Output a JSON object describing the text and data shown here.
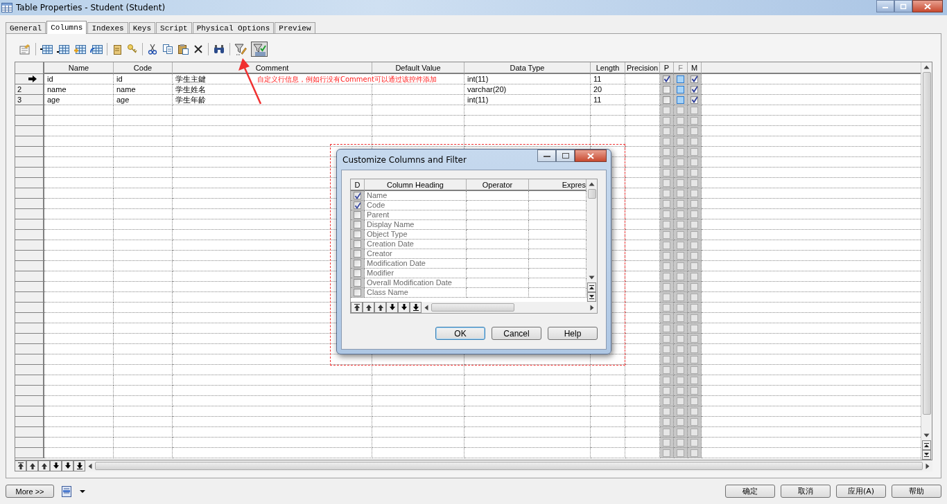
{
  "window": {
    "title": "Table Properties - Student (Student)"
  },
  "tabs": [
    {
      "label": "General",
      "selected": false
    },
    {
      "label": "Columns",
      "selected": true
    },
    {
      "label": "Indexes",
      "selected": false
    },
    {
      "label": "Keys",
      "selected": false
    },
    {
      "label": "Script",
      "selected": false
    },
    {
      "label": "Physical Options",
      "selected": false
    },
    {
      "label": "Preview",
      "selected": false
    }
  ],
  "toolbar": {
    "filter_pressed": true
  },
  "grid": {
    "columns": [
      {
        "label": "Name",
        "disabled": false
      },
      {
        "label": "Code",
        "disabled": false
      },
      {
        "label": "Comment",
        "disabled": false
      },
      {
        "label": "Default Value",
        "disabled": false
      },
      {
        "label": "Data Type",
        "disabled": false
      },
      {
        "label": "Length",
        "disabled": false
      },
      {
        "label": "Precision",
        "disabled": false
      },
      {
        "label": "P",
        "disabled": false
      },
      {
        "label": "F",
        "disabled": true
      },
      {
        "label": "M",
        "disabled": false
      }
    ],
    "rows": [
      {
        "current": true,
        "name": "id",
        "code": "id",
        "comment": "学生主鍵",
        "data_type": "int(11)",
        "length": "11",
        "p": true,
        "f": false,
        "m": true
      },
      {
        "current": false,
        "number": "2",
        "name": "name",
        "code": "name",
        "comment": "学生姓名",
        "data_type": "varchar(20)",
        "length": "20",
        "p": false,
        "f": false,
        "m": true
      },
      {
        "current": false,
        "number": "3",
        "name": "age",
        "code": "age",
        "comment": "学生年龄",
        "data_type": "int(11)",
        "length": "11",
        "p": false,
        "f": false,
        "m": true
      }
    ],
    "blank_rows": [
      {
        "p": false,
        "f": false,
        "m": false
      },
      {
        "p": false,
        "f": false,
        "m": false
      },
      {
        "p": false,
        "f": false,
        "m": false
      },
      {
        "p": false,
        "f": false,
        "m": false
      },
      {
        "p": false,
        "f": false,
        "m": false
      },
      {
        "p": false,
        "f": false,
        "m": false
      },
      {
        "p": false,
        "f": false,
        "m": false
      },
      {
        "p": false,
        "f": false,
        "m": false
      },
      {
        "p": false,
        "f": false,
        "m": false
      },
      {
        "p": false,
        "f": false,
        "m": false
      },
      {
        "p": false,
        "f": false,
        "m": false
      },
      {
        "p": false,
        "f": false,
        "m": false
      },
      {
        "p": false,
        "f": false,
        "m": false
      },
      {
        "p": false,
        "f": false,
        "m": false
      },
      {
        "p": false,
        "f": false,
        "m": false
      },
      {
        "p": false,
        "f": false,
        "m": false
      },
      {
        "p": false,
        "f": false,
        "m": false
      },
      {
        "p": false,
        "f": false,
        "m": false
      },
      {
        "p": false,
        "f": false,
        "m": false
      },
      {
        "p": false,
        "f": false,
        "m": false
      },
      {
        "p": false,
        "f": false,
        "m": false
      },
      {
        "p": false,
        "f": false,
        "m": false
      },
      {
        "p": false,
        "f": false,
        "m": false
      },
      {
        "p": false,
        "f": false,
        "m": false
      },
      {
        "p": false,
        "f": false,
        "m": false
      },
      {
        "p": false,
        "f": false,
        "m": false
      },
      {
        "p": false,
        "f": false,
        "m": false
      },
      {
        "p": false,
        "f": false,
        "m": false
      },
      {
        "p": false,
        "f": false,
        "m": false
      },
      {
        "p": false,
        "f": false,
        "m": false
      },
      {
        "p": false,
        "f": false,
        "m": false
      },
      {
        "p": false,
        "f": false,
        "m": false
      },
      {
        "p": false,
        "f": false,
        "m": false
      },
      {
        "p": false,
        "f": false,
        "m": false
      }
    ]
  },
  "annotation": {
    "text": "自定义行信息，例如行没有Comment可以通过该控件添加"
  },
  "dialog": {
    "title": "Customize Columns and Filter",
    "columns": [
      "D",
      "Column Heading",
      "Operator",
      "Expres"
    ],
    "items": [
      {
        "label": "Name",
        "checked": true
      },
      {
        "label": "Code",
        "checked": true
      },
      {
        "label": "Parent",
        "checked": false
      },
      {
        "label": "Display Name",
        "checked": false
      },
      {
        "label": "Object Type",
        "checked": false
      },
      {
        "label": "Creation Date",
        "checked": false
      },
      {
        "label": "Creator",
        "checked": false
      },
      {
        "label": "Modification Date",
        "checked": false
      },
      {
        "label": "Modifier",
        "checked": false
      },
      {
        "label": "Overall Modification Date",
        "checked": false
      },
      {
        "label": "Class Name",
        "checked": false
      }
    ],
    "buttons": [
      {
        "label": "OK",
        "default": true
      },
      {
        "label": "Cancel",
        "default": false
      },
      {
        "label": "Help",
        "default": false
      }
    ]
  },
  "footer": {
    "more": "More >>",
    "buttons": [
      "确定",
      "取消",
      "应用(A)",
      "帮助"
    ]
  }
}
